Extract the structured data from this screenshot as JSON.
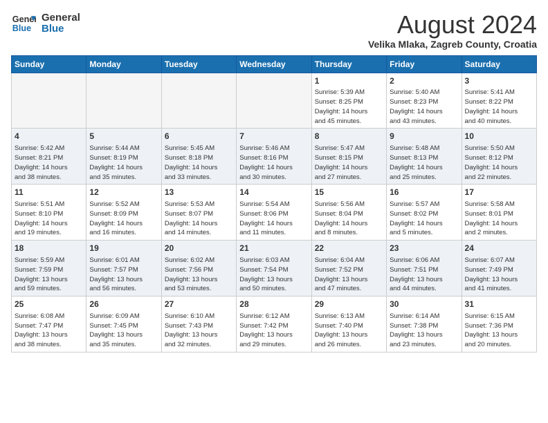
{
  "header": {
    "logo_general": "General",
    "logo_blue": "Blue",
    "month_year": "August 2024",
    "location": "Velika Mlaka, Zagreb County, Croatia"
  },
  "weekdays": [
    "Sunday",
    "Monday",
    "Tuesday",
    "Wednesday",
    "Thursday",
    "Friday",
    "Saturday"
  ],
  "weeks": [
    [
      {
        "day": "",
        "info": ""
      },
      {
        "day": "",
        "info": ""
      },
      {
        "day": "",
        "info": ""
      },
      {
        "day": "",
        "info": ""
      },
      {
        "day": "1",
        "info": "Sunrise: 5:39 AM\nSunset: 8:25 PM\nDaylight: 14 hours\nand 45 minutes."
      },
      {
        "day": "2",
        "info": "Sunrise: 5:40 AM\nSunset: 8:23 PM\nDaylight: 14 hours\nand 43 minutes."
      },
      {
        "day": "3",
        "info": "Sunrise: 5:41 AM\nSunset: 8:22 PM\nDaylight: 14 hours\nand 40 minutes."
      }
    ],
    [
      {
        "day": "4",
        "info": "Sunrise: 5:42 AM\nSunset: 8:21 PM\nDaylight: 14 hours\nand 38 minutes."
      },
      {
        "day": "5",
        "info": "Sunrise: 5:44 AM\nSunset: 8:19 PM\nDaylight: 14 hours\nand 35 minutes."
      },
      {
        "day": "6",
        "info": "Sunrise: 5:45 AM\nSunset: 8:18 PM\nDaylight: 14 hours\nand 33 minutes."
      },
      {
        "day": "7",
        "info": "Sunrise: 5:46 AM\nSunset: 8:16 PM\nDaylight: 14 hours\nand 30 minutes."
      },
      {
        "day": "8",
        "info": "Sunrise: 5:47 AM\nSunset: 8:15 PM\nDaylight: 14 hours\nand 27 minutes."
      },
      {
        "day": "9",
        "info": "Sunrise: 5:48 AM\nSunset: 8:13 PM\nDaylight: 14 hours\nand 25 minutes."
      },
      {
        "day": "10",
        "info": "Sunrise: 5:50 AM\nSunset: 8:12 PM\nDaylight: 14 hours\nand 22 minutes."
      }
    ],
    [
      {
        "day": "11",
        "info": "Sunrise: 5:51 AM\nSunset: 8:10 PM\nDaylight: 14 hours\nand 19 minutes."
      },
      {
        "day": "12",
        "info": "Sunrise: 5:52 AM\nSunset: 8:09 PM\nDaylight: 14 hours\nand 16 minutes."
      },
      {
        "day": "13",
        "info": "Sunrise: 5:53 AM\nSunset: 8:07 PM\nDaylight: 14 hours\nand 14 minutes."
      },
      {
        "day": "14",
        "info": "Sunrise: 5:54 AM\nSunset: 8:06 PM\nDaylight: 14 hours\nand 11 minutes."
      },
      {
        "day": "15",
        "info": "Sunrise: 5:56 AM\nSunset: 8:04 PM\nDaylight: 14 hours\nand 8 minutes."
      },
      {
        "day": "16",
        "info": "Sunrise: 5:57 AM\nSunset: 8:02 PM\nDaylight: 14 hours\nand 5 minutes."
      },
      {
        "day": "17",
        "info": "Sunrise: 5:58 AM\nSunset: 8:01 PM\nDaylight: 14 hours\nand 2 minutes."
      }
    ],
    [
      {
        "day": "18",
        "info": "Sunrise: 5:59 AM\nSunset: 7:59 PM\nDaylight: 13 hours\nand 59 minutes."
      },
      {
        "day": "19",
        "info": "Sunrise: 6:01 AM\nSunset: 7:57 PM\nDaylight: 13 hours\nand 56 minutes."
      },
      {
        "day": "20",
        "info": "Sunrise: 6:02 AM\nSunset: 7:56 PM\nDaylight: 13 hours\nand 53 minutes."
      },
      {
        "day": "21",
        "info": "Sunrise: 6:03 AM\nSunset: 7:54 PM\nDaylight: 13 hours\nand 50 minutes."
      },
      {
        "day": "22",
        "info": "Sunrise: 6:04 AM\nSunset: 7:52 PM\nDaylight: 13 hours\nand 47 minutes."
      },
      {
        "day": "23",
        "info": "Sunrise: 6:06 AM\nSunset: 7:51 PM\nDaylight: 13 hours\nand 44 minutes."
      },
      {
        "day": "24",
        "info": "Sunrise: 6:07 AM\nSunset: 7:49 PM\nDaylight: 13 hours\nand 41 minutes."
      }
    ],
    [
      {
        "day": "25",
        "info": "Sunrise: 6:08 AM\nSunset: 7:47 PM\nDaylight: 13 hours\nand 38 minutes."
      },
      {
        "day": "26",
        "info": "Sunrise: 6:09 AM\nSunset: 7:45 PM\nDaylight: 13 hours\nand 35 minutes."
      },
      {
        "day": "27",
        "info": "Sunrise: 6:10 AM\nSunset: 7:43 PM\nDaylight: 13 hours\nand 32 minutes."
      },
      {
        "day": "28",
        "info": "Sunrise: 6:12 AM\nSunset: 7:42 PM\nDaylight: 13 hours\nand 29 minutes."
      },
      {
        "day": "29",
        "info": "Sunrise: 6:13 AM\nSunset: 7:40 PM\nDaylight: 13 hours\nand 26 minutes."
      },
      {
        "day": "30",
        "info": "Sunrise: 6:14 AM\nSunset: 7:38 PM\nDaylight: 13 hours\nand 23 minutes."
      },
      {
        "day": "31",
        "info": "Sunrise: 6:15 AM\nSunset: 7:36 PM\nDaylight: 13 hours\nand 20 minutes."
      }
    ]
  ]
}
